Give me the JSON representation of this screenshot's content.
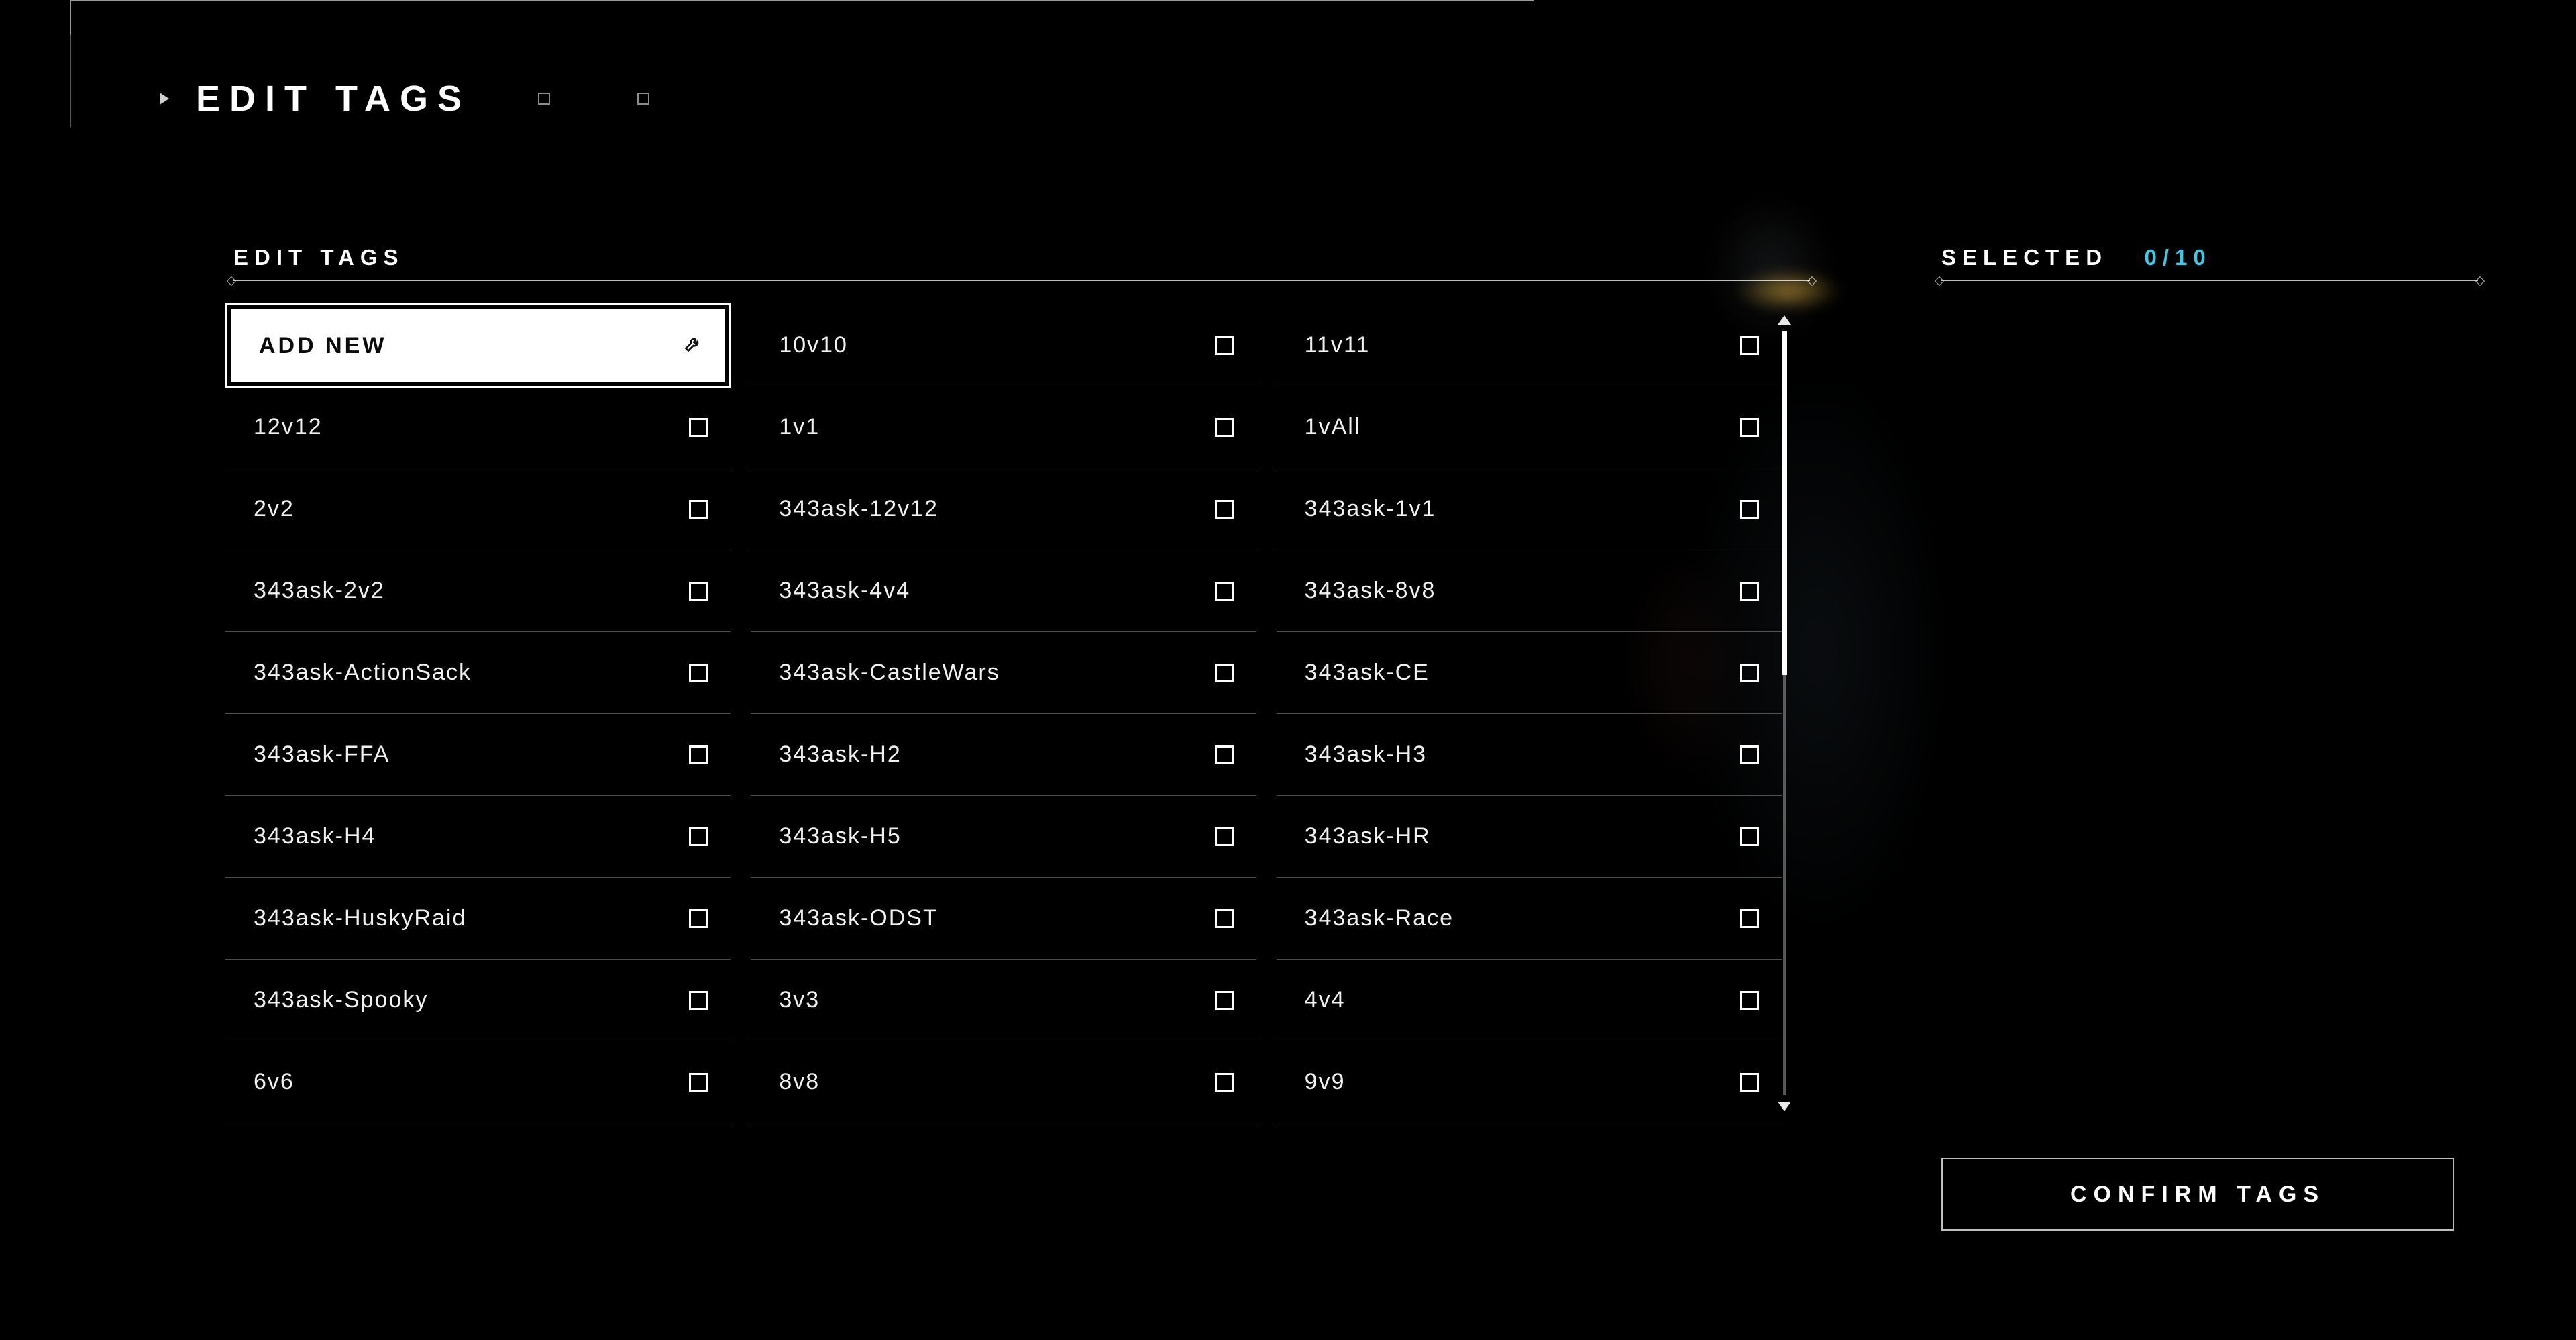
{
  "page_title": "EDIT TAGS",
  "section_label": "EDIT TAGS",
  "selected": {
    "label": "SELECTED",
    "count": "0/10"
  },
  "add_new_label": "ADD NEW",
  "confirm_label": "CONFIRM TAGS",
  "tags": [
    {
      "label": "10v10",
      "checked": false
    },
    {
      "label": "11v11",
      "checked": false
    },
    {
      "label": "12v12",
      "checked": false
    },
    {
      "label": "1v1",
      "checked": false
    },
    {
      "label": "1vAll",
      "checked": false
    },
    {
      "label": "2v2",
      "checked": false
    },
    {
      "label": "343ask-12v12",
      "checked": false
    },
    {
      "label": "343ask-1v1",
      "checked": false
    },
    {
      "label": "343ask-2v2",
      "checked": false
    },
    {
      "label": "343ask-4v4",
      "checked": false
    },
    {
      "label": "343ask-8v8",
      "checked": false
    },
    {
      "label": "343ask-ActionSack",
      "checked": false
    },
    {
      "label": "343ask-CastleWars",
      "checked": false
    },
    {
      "label": "343ask-CE",
      "checked": false
    },
    {
      "label": "343ask-FFA",
      "checked": false
    },
    {
      "label": "343ask-H2",
      "checked": false
    },
    {
      "label": "343ask-H3",
      "checked": false
    },
    {
      "label": "343ask-H4",
      "checked": false
    },
    {
      "label": "343ask-H5",
      "checked": false
    },
    {
      "label": "343ask-HR",
      "checked": false
    },
    {
      "label": "343ask-HuskyRaid",
      "checked": false
    },
    {
      "label": "343ask-ODST",
      "checked": false
    },
    {
      "label": "343ask-Race",
      "checked": false
    },
    {
      "label": "343ask-Spooky",
      "checked": false
    },
    {
      "label": "3v3",
      "checked": false
    },
    {
      "label": "4v4",
      "checked": false
    },
    {
      "label": "6v6",
      "checked": false
    },
    {
      "label": "8v8",
      "checked": false
    },
    {
      "label": "9v9",
      "checked": false
    }
  ]
}
